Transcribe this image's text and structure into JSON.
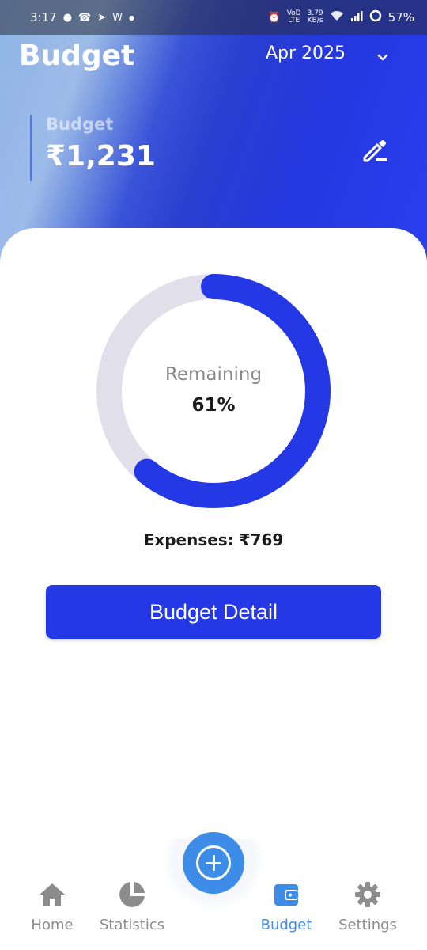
{
  "status_bar": {
    "time": "3:17",
    "lte_label_top": "VoD",
    "lte_label_bottom": "LTE",
    "speed_value": "3.79",
    "speed_unit": "KB/s",
    "battery": "57%"
  },
  "header": {
    "title": "Budget",
    "month": "Apr 2025"
  },
  "budget_card": {
    "label": "Budget",
    "amount": "₹1,231"
  },
  "progress": {
    "label": "Remaining",
    "value_text": "61%",
    "remaining_fraction": 0.61
  },
  "expenses": {
    "label": "Expenses:",
    "amount": "₹769"
  },
  "detail_button": {
    "label": "Budget Detail"
  },
  "nav": {
    "items": [
      {
        "label": "Home",
        "icon": "home-icon"
      },
      {
        "label": "Statistics",
        "icon": "pie-chart-icon"
      },
      {
        "label": "Budget",
        "icon": "wallet-icon",
        "active": true
      },
      {
        "label": "Settings",
        "icon": "gear-icon"
      }
    ],
    "fab_icon": "plus-icon"
  },
  "colors": {
    "accent": "#2438e6",
    "nav_active": "#3d8de8",
    "ring_track": "#e1e0ea",
    "ring_fill": "#2438e6"
  }
}
